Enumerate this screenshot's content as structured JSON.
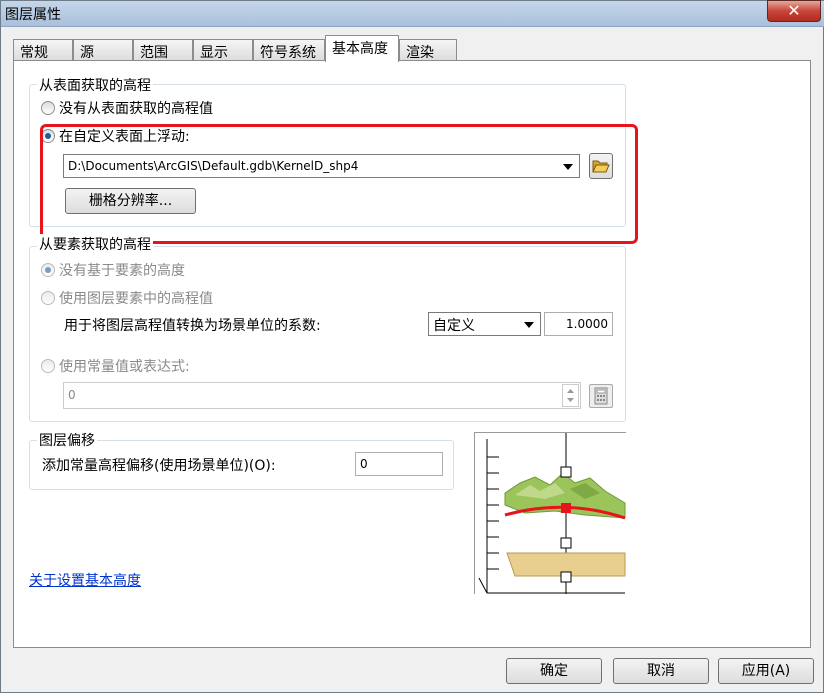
{
  "window": {
    "title": "图层属性",
    "close_label": "✕"
  },
  "tabs": [
    {
      "label": "常规"
    },
    {
      "label": "源"
    },
    {
      "label": "范围"
    },
    {
      "label": "显示"
    },
    {
      "label": "符号系统"
    },
    {
      "label": "基本高度"
    },
    {
      "label": "渲染"
    }
  ],
  "surface_group": {
    "title": "从表面获取的高程",
    "option_none": "没有从表面获取的高程值",
    "option_float": "在自定义表面上浮动:",
    "surface_path": "D:\\Documents\\ArcGIS\\Default.gdb\\KernelD_shp4",
    "raster_button": "栅格分辨率..."
  },
  "feature_group": {
    "title": "从要素获取的高程",
    "option_none": "没有基于要素的高度",
    "option_layer": "使用图层要素中的高程值",
    "factor_label": "用于将图层高程值转换为场景单位的系数:",
    "factor_select": "自定义",
    "factor_value": "1.0000",
    "option_expr": "使用常量值或表达式:",
    "expr_value": "0"
  },
  "offset_group": {
    "title": "图层偏移",
    "offset_label": "添加常量高程偏移(使用场景单位)(O):",
    "offset_value": "0"
  },
  "link": "关于设置基本高度",
  "buttons": {
    "ok": "确定",
    "cancel": "取消",
    "apply": "应用(A)"
  },
  "icons": {
    "browse": "folder-open-icon",
    "calculator": "calculator-icon",
    "close": "close-icon"
  },
  "colors": {
    "highlight": "#e8141b",
    "link": "#0033cc",
    "radio_selected": "#1c5d9c"
  }
}
